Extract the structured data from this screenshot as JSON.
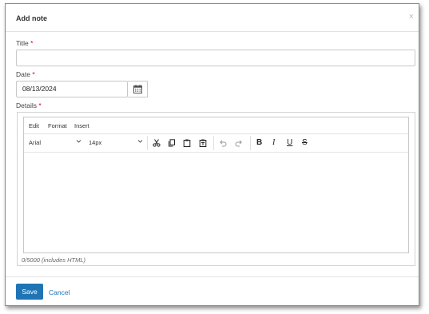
{
  "dialog": {
    "title": "Add note",
    "close_glyph": "×"
  },
  "form": {
    "title_label": "Title",
    "title_value": "",
    "date_label": "Date",
    "date_value": "08/13/2024",
    "details_label": "Details",
    "required_marker": "*"
  },
  "editor": {
    "menus": [
      "Edit",
      "Format",
      "Insert"
    ],
    "font_family": "Arial",
    "font_size": "14px",
    "bold_glyph": "B",
    "italic_glyph": "I",
    "underline_glyph": "U",
    "strike_glyph": "S",
    "content": "",
    "counter": "0/5000 (includes HTML)"
  },
  "footer": {
    "save_label": "Save",
    "cancel_label": "Cancel"
  },
  "icons": [
    "close-icon",
    "calendar-icon",
    "chevron-down-icon",
    "cut-icon",
    "copy-icon",
    "paste-icon",
    "paste-text-icon",
    "undo-icon",
    "redo-icon",
    "bold-icon",
    "italic-icon",
    "underline-icon",
    "strikethrough-icon"
  ],
  "colors": {
    "accent": "#1f74b5",
    "required": "#d0021b"
  }
}
